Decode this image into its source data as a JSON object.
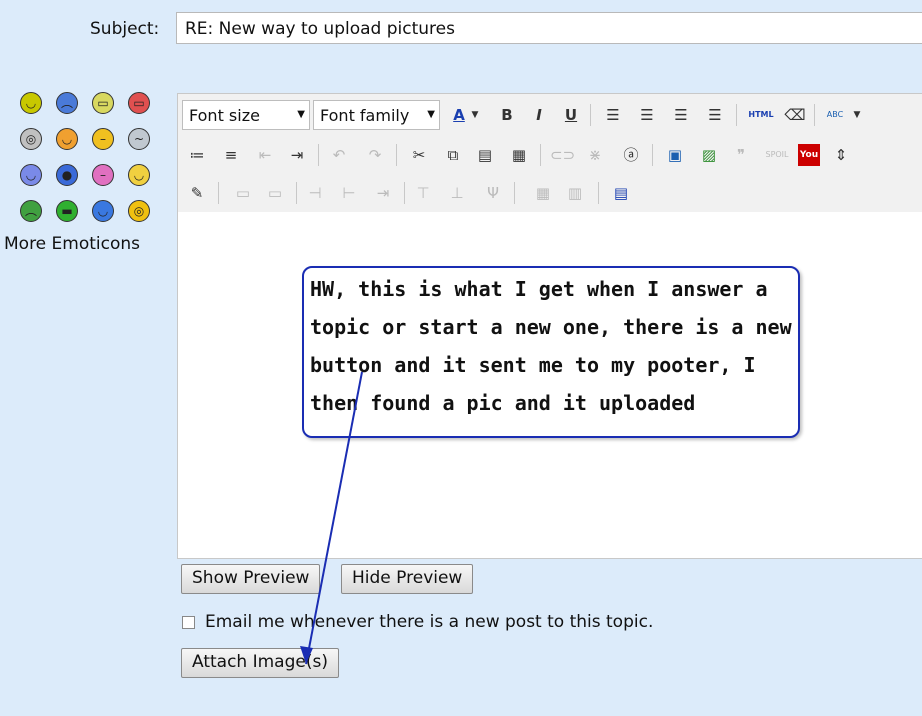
{
  "subject": {
    "label": "Subject:",
    "value": "RE: New way to upload pictures"
  },
  "emoticons": {
    "more_label": "More Emoticons",
    "items": [
      {
        "icon": "grin-emoticon",
        "color": "#c8c800"
      },
      {
        "icon": "sad-emoticon",
        "color": "#4a7ad8"
      },
      {
        "icon": "laughing-emoticon",
        "color": "#d8d860"
      },
      {
        "icon": "angry-emoticon",
        "color": "#e05050"
      },
      {
        "icon": "confused-emoticon",
        "color": "#c0c0c0"
      },
      {
        "icon": "blushing-emoticon",
        "color": "#f0a030"
      },
      {
        "icon": "neutral-emoticon",
        "color": "#f0c020"
      },
      {
        "icon": "sleepy-emoticon",
        "color": "#c0c8d0"
      },
      {
        "icon": "wink-emoticon",
        "color": "#7a8ae8"
      },
      {
        "icon": "shocked-emoticon",
        "color": "#3a6ad8"
      },
      {
        "icon": "annoyed-emoticon",
        "color": "#e070c0"
      },
      {
        "icon": "worried-emoticon",
        "color": "#f0d040"
      },
      {
        "icon": "sick-emoticon",
        "color": "#40a040"
      },
      {
        "icon": "cool-emoticon",
        "color": "#30b030"
      },
      {
        "icon": "crying-emoticon",
        "color": "#3a78e0"
      },
      {
        "icon": "thinking-emoticon",
        "color": "#f0c010"
      }
    ]
  },
  "toolbar": {
    "font_size": "Font size",
    "font_family": "Font family",
    "bold": "B",
    "italic": "I",
    "underline": "U",
    "html": "HTML",
    "abc": "ABC"
  },
  "editor": {
    "callout_lines": [
      "HW, this is what I get when I answer a",
      "topic or start a new one, there is a new",
      "button and it sent me to my pooter, I",
      "then found a pic and it uploaded"
    ]
  },
  "buttons": {
    "show_preview": "Show Preview",
    "hide_preview": "Hide Preview",
    "attach": "Attach Image(s)"
  },
  "email_option": "Email me whenever there is a new post to this topic.",
  "colors": {
    "background": "#dcebfa",
    "callout_border": "#1a2db3",
    "arrow": "#1a2db3"
  }
}
